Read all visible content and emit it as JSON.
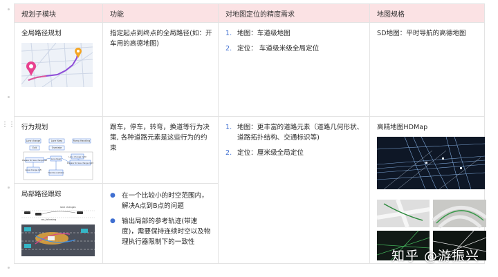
{
  "table": {
    "headers": [
      "规划子模块",
      "功能",
      "对地图定位的精度需求",
      "地图规格"
    ],
    "rows": [
      {
        "module": "全局路径规划",
        "function": "指定起点到终点的全局路径(如：开车用的高德地图)",
        "accuracy": [
          {
            "num": "1.",
            "text": "地图：车道级地图"
          },
          {
            "num": "2.",
            "text": "定位： 车道级米级全局定位"
          }
        ],
        "map_spec": "SD地图：平时导航的高德地图"
      },
      {
        "module": "行为规划",
        "function": "跟车，停车，转弯，换道等行为决策, 各种道路元素是这些行为的约束",
        "accuracy": [
          {
            "num": "1.",
            "text": "地图：更丰富的道路元素（道路几何形状、道路拓扑结构、交通标识等)"
          },
          {
            "num": "2.",
            "text": "定位：厘米级全局定位"
          }
        ],
        "map_spec": "高精地图HDMap"
      },
      {
        "module": "局部路径跟踪",
        "function_bullets": [
          "在一个比较小的时空范围内，解决A点到B点的问题",
          "输出局部的参考轨迹(带速度)，需要保持连续时空以及物理执行器限制下的一致性"
        ]
      }
    ]
  },
  "diagram": {
    "behavior_boxes": [
      "Lane change",
      "Lane Keep",
      "Ramp Handling",
      "Exit",
      "Overtake",
      "Prepare for lane change left",
      "Lane change left",
      "Prepare for lane change right",
      "Lane change right",
      "Handle overtake",
      "Lane Keep"
    ],
    "tracking_labels": [
      "lane changes",
      "car_following"
    ]
  },
  "watermark": "知乎 @游振兴",
  "colors": {
    "header_bg": "#fbe2e4",
    "accent": "#3f6fd1",
    "border": "#e3e3e3"
  }
}
